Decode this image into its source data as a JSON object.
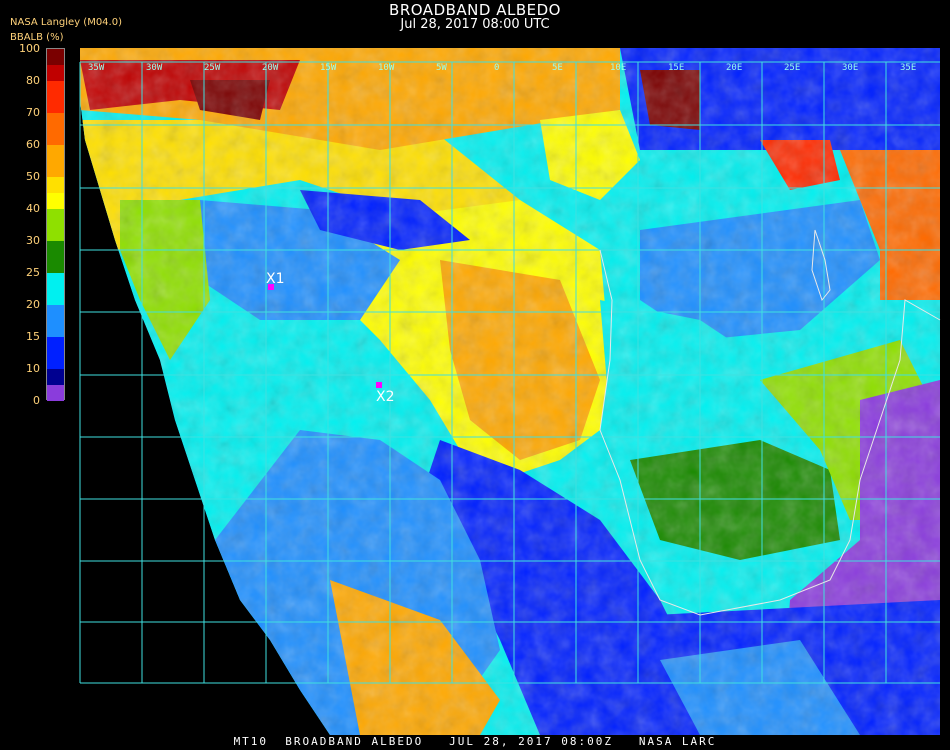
{
  "header": {
    "title": "BROADBAND ALBEDO",
    "subtitle": "Jul 28, 2017 08:00 UTC",
    "org_label": "NASA Langley (M04.0)",
    "param_label": "BBALB (%)"
  },
  "colorbar": {
    "ticks": [
      "100",
      "80",
      "70",
      "60",
      "50",
      "40",
      "30",
      "25",
      "20",
      "15",
      "10",
      "0"
    ],
    "segments": [
      {
        "from": 90,
        "to": 100,
        "color": "#7a0000"
      },
      {
        "from": 80,
        "to": 90,
        "color": "#c00000"
      },
      {
        "from": 70,
        "to": 80,
        "color": "#ff2a00"
      },
      {
        "from": 60,
        "to": 70,
        "color": "#ff6a00"
      },
      {
        "from": 50,
        "to": 60,
        "color": "#ffa800"
      },
      {
        "from": 45,
        "to": 50,
        "color": "#ffe000"
      },
      {
        "from": 40,
        "to": 45,
        "color": "#ffff00"
      },
      {
        "from": 30,
        "to": 40,
        "color": "#8fe000"
      },
      {
        "from": 25,
        "to": 30,
        "color": "#1a8a00"
      },
      {
        "from": 20,
        "to": 25,
        "color": "#00f0f0"
      },
      {
        "from": 15,
        "to": 20,
        "color": "#1e8fff"
      },
      {
        "from": 10,
        "to": 15,
        "color": "#0020ff"
      },
      {
        "from": 5,
        "to": 10,
        "color": "#000090"
      },
      {
        "from": 0,
        "to": 5,
        "color": "#8a3cdc"
      }
    ]
  },
  "map": {
    "longitude_labels": [
      "35W",
      "30W",
      "25W",
      "20W",
      "15W",
      "10W",
      "5W",
      "0",
      "5E",
      "10E",
      "15E",
      "20E",
      "25E",
      "30E",
      "35E"
    ],
    "markers": [
      {
        "label": "X1",
        "color": "#ff00ff"
      },
      {
        "label": "X2",
        "color": "#ff00ff"
      }
    ],
    "grid_color": "#3fe0e0"
  },
  "footer": {
    "text": "MT10  BROADBAND ALBEDO   JUL 28, 2017 08:00Z   NASA LARC"
  }
}
